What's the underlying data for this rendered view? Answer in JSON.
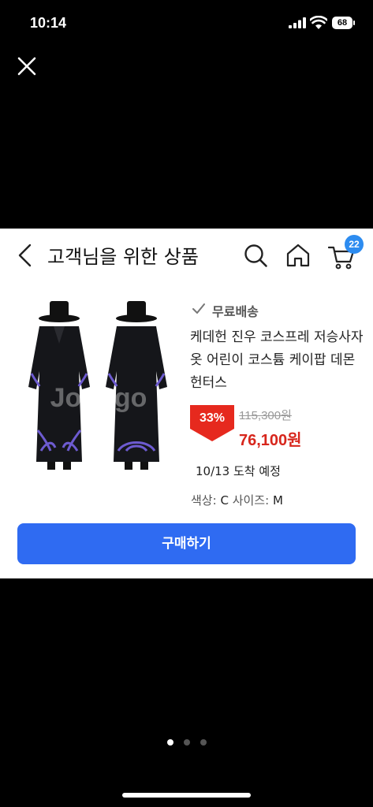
{
  "status_bar": {
    "time": "10:14",
    "battery": "68"
  },
  "header": {
    "title": "고객님을 위한 상품",
    "cart_count": "22"
  },
  "product": {
    "free_shipping": "무료배송",
    "title": "케데헌 진우 코스프레 저승사자 옷 어린이 코스튬 케이팝 데몬헌터스",
    "discount": "33%",
    "original_price": "115,300원",
    "sale_price": "76,100원",
    "delivery": "10/13 도착 예정",
    "options_label_color": "색상:",
    "options_color": "C",
    "options_label_size": "사이즈:",
    "options_size": "M",
    "watermark": "Joongo"
  },
  "buy_button": {
    "label": "구매하기"
  },
  "pager": {
    "count": 3,
    "active": 0
  },
  "colors": {
    "accent": "#2f6bf2",
    "sale": "#d7261c",
    "badge": "#2d8cf0"
  },
  "icons": [
    "close-icon",
    "chevron-left-icon",
    "search-icon",
    "home-icon",
    "cart-icon",
    "check-icon",
    "signal-icon",
    "wifi-icon",
    "battery-icon"
  ]
}
